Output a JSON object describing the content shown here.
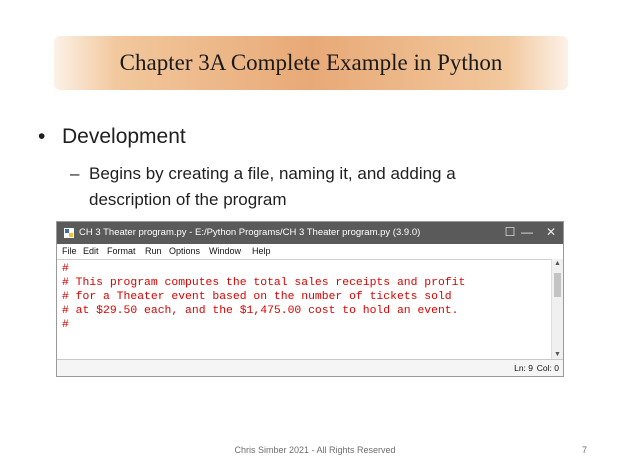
{
  "slide": {
    "title": "Chapter 3A Complete Example in Python",
    "bullet": "Development",
    "sub_bullet": "Begins by creating a file, naming it, and adding a description of the program",
    "footer": "Chris Simber 2021 - All Rights Reserved",
    "page_number": "7"
  },
  "window": {
    "title": "CH 3 Theater program.py - E:/Python Programs/CH 3 Theater program.py (3.9.0)",
    "controls": {
      "minimize": "—",
      "maximize": "☐",
      "close": "✕"
    },
    "menu": [
      "File",
      "Edit",
      "Format",
      "Run",
      "Options",
      "Window",
      "Help"
    ],
    "code_lines": [
      "#",
      "# This program computes the total sales receipts and profit",
      "# for a Theater event based on the number of tickets sold",
      "# at $29.50 each, and the $1,475.00 cost to hold an event.",
      "#"
    ],
    "status": {
      "line": "Ln: 9",
      "col": "Col: 0"
    }
  },
  "colors": {
    "code_comment": "#dd0000",
    "titlebar": "#5a5a5a",
    "banner": "#e8a977"
  },
  "icons": {
    "app": "python-idle-icon",
    "scroll_up": "scroll-up-arrow-icon",
    "scroll_down": "scroll-down-arrow-icon"
  }
}
